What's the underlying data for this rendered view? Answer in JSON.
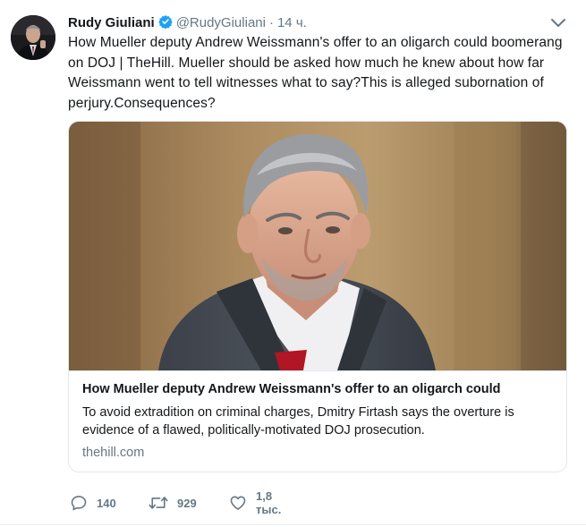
{
  "tweet": {
    "author_name": "Rudy Giuliani",
    "author_handle": "@RudyGiuliani",
    "separator": "·",
    "timestamp": "14 ч.",
    "text": "How Mueller deputy Andrew Weissmann's offer to an oligarch could boomerang on DOJ | TheHill. Mueller should be asked how much he knew about how far Weissmann went to tell witnesses what to say?This is alleged subornation of perjury.Consequences?"
  },
  "card": {
    "title": "How Mueller deputy Andrew Weissmann's offer to an oligarch could",
    "description": "To avoid extradition on criminal charges, Dmitry Firtash says the overture is evidence of a flawed, politically-motivated DOJ prosecution.",
    "domain": "thehill.com"
  },
  "actions": {
    "replies": "140",
    "retweets": "929",
    "likes": "1,8 тыс."
  },
  "colors": {
    "verified_badge": "#1da1f2",
    "secondary_text": "#657786",
    "border": "#e1e8ed",
    "tie_red": "#b01623"
  },
  "icons": {
    "verified": "verified-badge-icon",
    "caret": "chevron-down-icon",
    "reply": "reply-icon",
    "retweet": "retweet-icon",
    "like": "heart-icon"
  }
}
